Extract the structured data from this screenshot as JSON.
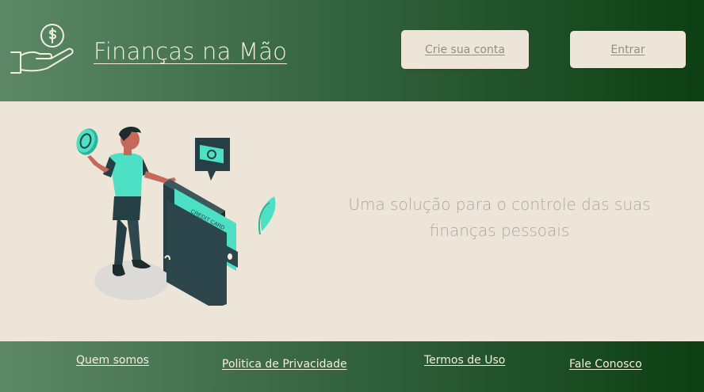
{
  "header": {
    "brand_name": "Finanças na Mão",
    "logo_icon": "hand-holding-dollar-icon",
    "signup_label": "Crie sua conta",
    "login_label": "Entrar"
  },
  "hero": {
    "tagline": "Uma solução para o controle das suas finanças pessoais",
    "illustration": "person-with-wallet-illustration",
    "card_text": "CREDIT CARD"
  },
  "footer": {
    "links": [
      "Quem somos",
      "Politica de Privacidade",
      "Termos de Uso",
      "Fale Conosco"
    ]
  },
  "colors": {
    "header_gradient_start": "#5c8868",
    "header_gradient_end": "#0d3f12",
    "background": "#ede6d8",
    "accent_teal": "#4ee0c5",
    "dark_slate": "#263f44"
  }
}
